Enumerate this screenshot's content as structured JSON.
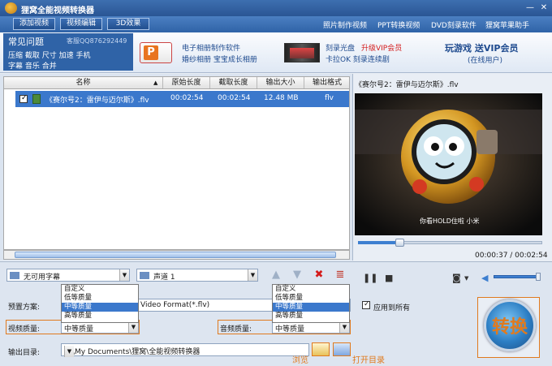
{
  "app": {
    "title": "狸窝全能视频转换器"
  },
  "window_controls": {
    "minimize": "—",
    "close": "✕"
  },
  "toolbar": {
    "add_video": "添加视频",
    "edit_video": "视频编辑",
    "effect_3d": "3D效果",
    "links": [
      "照片制作视频",
      "PPT转换视频",
      "DVD刻录软件",
      "狸窝苹果助手"
    ]
  },
  "banner": {
    "faq_title": "常见问题",
    "faq_qq": "客服QQ876292449",
    "faq_links_row1": "压缩 截取 尺寸 加速 手机",
    "faq_links_row2": "字幕 音乐 合并",
    "ad1_line1": "电子相册制作软件",
    "ad1_line2": "婚纱相册 宝宝成长相册",
    "ad2_line1a": "刻录光盘",
    "ad2_line1b": "升级VIP会员",
    "ad2_line2": "卡拉OK 刻录连续剧",
    "ad3_line1": "玩游戏 送VIP会员",
    "ad3_line2": "(在线用户)"
  },
  "file_list": {
    "columns": [
      "名称",
      "原始长度",
      "截取长度",
      "输出大小",
      "输出格式"
    ],
    "rows": [
      {
        "name": "《赛尔号2：雷伊与迈尔斯》.flv",
        "original_length": "00:02:54",
        "clip_length": "00:02:54",
        "output_size": "12.48 MB",
        "output_format": "flv"
      }
    ]
  },
  "subtitle_select": {
    "value": "无可用字幕"
  },
  "audio_track_select": {
    "value": "声道 1"
  },
  "list_buttons": {
    "up": "▲",
    "down": "▼",
    "delete": "✖",
    "clear": "≣"
  },
  "preset": {
    "label": "预置方案:",
    "value": "Video Format(*.flv)"
  },
  "quality_options": [
    "自定义",
    "低等质量",
    "中等质量",
    "高等质量"
  ],
  "video_quality": {
    "label": "视频质量:",
    "value": "中等质量"
  },
  "audio_quality": {
    "label": "音频质量:",
    "value": "中等质量"
  },
  "apply_all": {
    "label": "应用到所有"
  },
  "output": {
    "label": "输出目录:",
    "path": "D:\\My Documents\\狸窝\\全能视频转换器",
    "browse": "浏览",
    "open": "打开目录"
  },
  "convert_button": {
    "label": "转换"
  },
  "preview": {
    "title": "《赛尔号2：雷伊与迈尔斯》.flv",
    "caption": "你看HOLD住啦 小米",
    "time": "00:00:37 / 00:02:54",
    "progress": 0.21
  },
  "accent_colors": {
    "selection": "#3b78cc",
    "highlight": "#e07a1e"
  }
}
